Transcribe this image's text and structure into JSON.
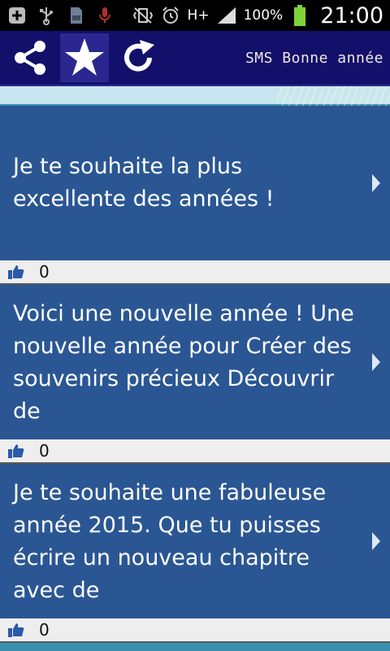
{
  "status_bar": {
    "icons": [
      "add-box-icon",
      "usb-icon",
      "sd-card-icon",
      "mic-icon",
      "vibrate-muted-icon",
      "alarm-icon",
      "hplus-data-icon",
      "signal-icon",
      "battery-icon"
    ],
    "battery_percent": "100%",
    "time": "21:00",
    "network_label": "H+"
  },
  "appbar": {
    "title": "SMS Bonne année",
    "actions": [
      "share-icon",
      "star-icon",
      "refresh-icon"
    ]
  },
  "messages": [
    {
      "text": "Je te souhaite la plus excellente des années !",
      "likes": "0"
    },
    {
      "text": "Voici une nouvelle année ! Une nouvelle année pour Créer des souvenirs précieux Découvrir de",
      "likes": "0"
    },
    {
      "text": "Je te souhaite une fabuleuse année 2015. Que tu puisses écrire un nouveau chapitre avec de",
      "likes": "0"
    }
  ],
  "colors": {
    "appbar": "#12106b",
    "card": "#2a5693",
    "likebar": "#eeeeee",
    "background": "#3a8fb0"
  }
}
